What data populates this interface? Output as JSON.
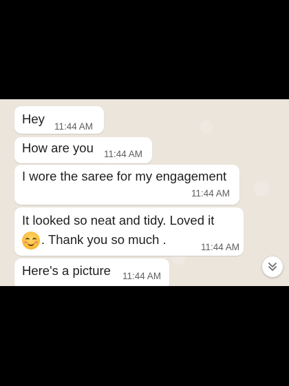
{
  "messages": [
    {
      "text": "Hey",
      "time": "11:44 AM"
    },
    {
      "text": "How are you",
      "time": "11:44 AM"
    },
    {
      "text": "I wore the saree for my engagement",
      "time": "11:44 AM"
    },
    {
      "line1": "It looked so neat and tidy. Loved it",
      "emoji": "smiling-face-with-smiling-eyes",
      "line2": ". Thank you so much .",
      "time": "11:44 AM"
    },
    {
      "text": "Here's a picture",
      "time": "11:44 AM"
    }
  ],
  "scroll_button": {
    "icon": "double-chevron-down-icon"
  },
  "colors": {
    "chat_background": "#ebe5dc",
    "bubble": "#ffffff",
    "letterbox": "#000000"
  }
}
